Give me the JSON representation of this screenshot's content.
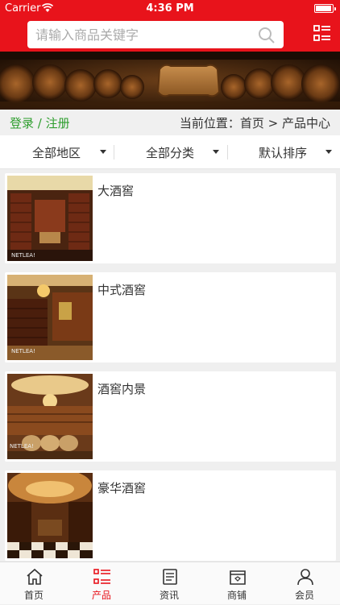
{
  "status_bar": {
    "carrier": "Carrier",
    "time": "4:36 PM"
  },
  "header": {
    "search_placeholder": "请输入商品关键字"
  },
  "nav": {
    "login": "登录",
    "separator": " / ",
    "register": "注册",
    "location": "当前位置：首页 > 产品中心"
  },
  "filters": [
    {
      "label": "全部地区"
    },
    {
      "label": "全部分类"
    },
    {
      "label": "默认排序"
    }
  ],
  "products": [
    {
      "title": "大酒窖"
    },
    {
      "title": "中式酒窖"
    },
    {
      "title": "酒窖内景"
    },
    {
      "title": "豪华酒窖"
    }
  ],
  "tabs": [
    {
      "label": "首页",
      "icon": "home-icon"
    },
    {
      "label": "产品",
      "icon": "product-list-icon",
      "active": true
    },
    {
      "label": "资讯",
      "icon": "news-icon"
    },
    {
      "label": "商铺",
      "icon": "store-icon"
    },
    {
      "label": "会员",
      "icon": "member-icon"
    }
  ],
  "colors": {
    "accent": "#e8131b",
    "link": "#2e9e2e"
  }
}
